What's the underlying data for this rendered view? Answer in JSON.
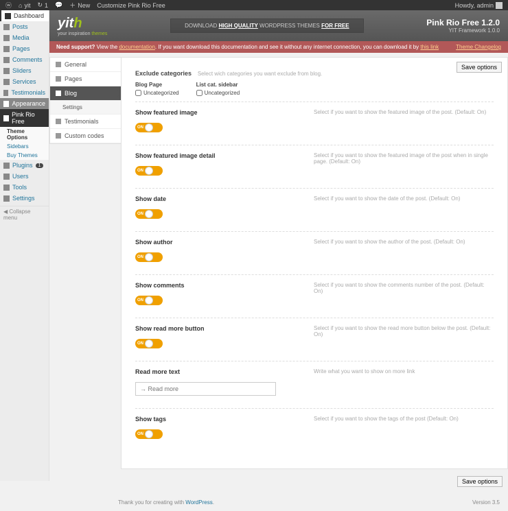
{
  "adminbar": {
    "site": "yit",
    "refresh": "1",
    "new": "New",
    "customize": "Customize Pink Rio Free",
    "howdy": "Howdy, admin"
  },
  "sidebar": {
    "items": [
      "Dashboard",
      "Posts",
      "Media",
      "Pages",
      "Comments",
      "Sliders",
      "Services",
      "Testimonials",
      "Appearance",
      "Pink Rio Free",
      "Plugins",
      "Users",
      "Tools",
      "Settings"
    ],
    "sub": {
      "theme_options": "Theme Options",
      "sidebars": "Sidebars",
      "buy_themes": "Buy Themes"
    },
    "plugins_badge": "1",
    "collapse": "Collapse menu"
  },
  "banner": {
    "logo": "yit",
    "logo_h": "h",
    "logo_sub1": "your inspiration ",
    "logo_sub2": "themes",
    "promo_pre": "DOWNLOAD ",
    "promo_hq": "HIGH QUALITY",
    "promo_mid": " WORDPRESS THEMES ",
    "promo_free": "FOR FREE",
    "version": "Pink Rio Free 1.2.0",
    "framework": "YIT Framework 1.0.0"
  },
  "notice": {
    "need": "Need support? ",
    "view": "View the ",
    "doc": "documentation",
    "rest": ". If you want download this documentation and see it without any internet connection, you can download it by ",
    "link": "this link",
    "changelog": "Theme Changelog"
  },
  "panel_tabs": [
    "General",
    "Pages",
    "Blog",
    "Settings",
    "Testimonials",
    "Custom codes"
  ],
  "exclude": {
    "title": "Exclude categories",
    "desc": "Select wich categories you want exclude from blog.",
    "blog_page": "Blog Page",
    "list_cat": "List cat. sidebar",
    "uncat": "Uncategorized"
  },
  "toggles": [
    {
      "title": "Show featured image",
      "desc": "Select if you want to show the featured image of the post. (Default: On)"
    },
    {
      "title": "Show featured image detail",
      "desc": "Select if you want to show the featured image of the post when in single page. (Default: On)"
    },
    {
      "title": "Show date",
      "desc": "Select if you want to show the date of the post. (Default: On)"
    },
    {
      "title": "Show author",
      "desc": "Select if you want to show the author of the post. (Default: On)"
    },
    {
      "title": "Show comments",
      "desc": "Select if you want to show the comments number of the post. (Default: On)"
    },
    {
      "title": "Show read more button",
      "desc": "Select if you want to show the read more button below the post. (Default: On)"
    }
  ],
  "readmore": {
    "title": "Read more text",
    "value": "→ Read more",
    "desc": "Write what you want to show on more link"
  },
  "show_tags": {
    "title": "Show tags",
    "desc": "Select if you want to show the tags of the post (Default: On)"
  },
  "save": "Save options",
  "footer": {
    "thank": "Thank you for creating with ",
    "wp": "WordPress",
    "version": "Version 3.5"
  }
}
